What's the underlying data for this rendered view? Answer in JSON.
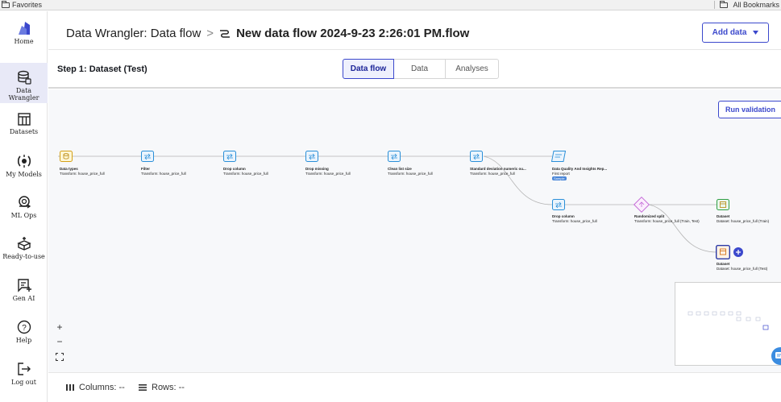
{
  "bookmarks": {
    "favorites": "Favorites",
    "all_bookmarks": "All Bookmarks"
  },
  "sidebar": {
    "items": [
      {
        "label": "Home",
        "icon": "logo-icon"
      },
      {
        "label": "Data Wrangler",
        "icon": "database-icon",
        "active": true
      },
      {
        "label": "Datasets",
        "icon": "table-icon"
      },
      {
        "label": "My Models",
        "icon": "model-icon"
      },
      {
        "label": "ML Ops",
        "icon": "mlops-icon"
      },
      {
        "label": "Ready-to-use",
        "icon": "box-icon"
      },
      {
        "label": "Gen AI",
        "icon": "genai-icon"
      },
      {
        "label": "Help",
        "icon": "help-icon"
      },
      {
        "label": "Log out",
        "icon": "logout-icon"
      }
    ]
  },
  "header": {
    "breadcrumb_root": "Data Wrangler: Data flow",
    "separator": ">",
    "flow_name": "New data flow 2024-9-23 2:26:01 PM.flow",
    "add_data_label": "Add data"
  },
  "stepbar": {
    "title": "Step 1: Dataset (Test)",
    "tabs": [
      "Data flow",
      "Data",
      "Analyses"
    ]
  },
  "canvas": {
    "run_validation_label": "Run validation",
    "nodes": [
      {
        "title": "Data types",
        "subtitle": "Transform: house_price_full"
      },
      {
        "title": "Filter",
        "subtitle": "Transform: house_price_full"
      },
      {
        "title": "Drop column",
        "subtitle": "Transform: house_price_full"
      },
      {
        "title": "Drop missing",
        "subtitle": "Transform: house_price_full"
      },
      {
        "title": "Clean list size",
        "subtitle": "Transform: house_price_full"
      },
      {
        "title": "Standard deviation numeric ou...",
        "subtitle": "Transform: house_price_full"
      },
      {
        "title": "Data Quality And Insights Rep...",
        "subtitle": "First report",
        "badge": "Sample"
      },
      {
        "title": "Drop column",
        "subtitle": "Transform: house_price_full"
      },
      {
        "title": "Randomized split",
        "subtitle": "Transform: house_price_full (Train, Test)"
      },
      {
        "title": "Dataset",
        "subtitle": "Dataset: house_price_full (Train)"
      },
      {
        "title": "Dataset",
        "subtitle": "Dataset: house_price_full (Test)"
      }
    ],
    "zoom_in": "+",
    "zoom_out": "−"
  },
  "footer": {
    "columns": "Columns: --",
    "rows": "Rows: --"
  },
  "colors": {
    "accent": "#3b48cc",
    "transform": "#2a8fd8",
    "dataset_train": "#2f9e44",
    "dataset_source": "#d4a017",
    "split": "#c46ad8"
  }
}
